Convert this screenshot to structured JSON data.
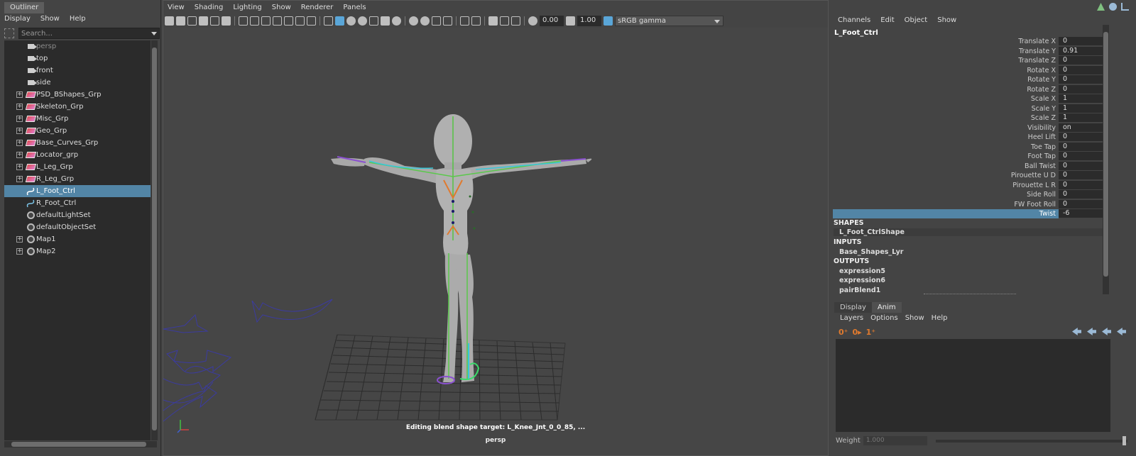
{
  "outliner": {
    "tab": "Outliner",
    "menu": [
      "Display",
      "Show",
      "Help"
    ],
    "search_placeholder": "Search...",
    "items": [
      {
        "label": "persp",
        "type": "camera",
        "expandable": false,
        "dim": true
      },
      {
        "label": "top",
        "type": "camera",
        "expandable": false
      },
      {
        "label": "front",
        "type": "camera",
        "expandable": false
      },
      {
        "label": "side",
        "type": "camera",
        "expandable": false
      },
      {
        "label": "PSD_BShapes_Grp",
        "type": "group",
        "expandable": true
      },
      {
        "label": "Skeleton_Grp",
        "type": "group",
        "expandable": true
      },
      {
        "label": "Misc_Grp",
        "type": "group",
        "expandable": true
      },
      {
        "label": "Geo_Grp",
        "type": "group",
        "expandable": true
      },
      {
        "label": "Base_Curves_Grp",
        "type": "group",
        "expandable": true
      },
      {
        "label": "Locator_grp",
        "type": "group",
        "expandable": true
      },
      {
        "label": "L_Leg_Grp",
        "type": "group",
        "expandable": true
      },
      {
        "label": "R_Leg_Grp",
        "type": "group",
        "expandable": true
      },
      {
        "label": "L_Foot_Ctrl",
        "type": "curve",
        "expandable": false,
        "selected": true
      },
      {
        "label": "R_Foot_Ctrl",
        "type": "curve",
        "expandable": false
      },
      {
        "label": "defaultLightSet",
        "type": "set",
        "expandable": false
      },
      {
        "label": "defaultObjectSet",
        "type": "set",
        "expandable": false
      },
      {
        "label": "Map1",
        "type": "set",
        "expandable": true
      },
      {
        "label": "Map2",
        "type": "set",
        "expandable": true
      }
    ]
  },
  "viewport": {
    "menu": [
      "View",
      "Shading",
      "Lighting",
      "Show",
      "Renderer",
      "Panels"
    ],
    "exposure": "0.00",
    "gamma": "1.00",
    "color_space": "sRGB gamma",
    "hud_message": "Editing blend shape target: L_Knee_Jnt_0_0_85, ...",
    "camera_name": "persp"
  },
  "channel_box": {
    "menu": [
      "Channels",
      "Edit",
      "Object",
      "Show"
    ],
    "object_name": "L_Foot_Ctrl",
    "attributes": [
      {
        "name": "Translate X",
        "value": "0"
      },
      {
        "name": "Translate Y",
        "value": "0.91"
      },
      {
        "name": "Translate Z",
        "value": "0"
      },
      {
        "name": "Rotate X",
        "value": "0"
      },
      {
        "name": "Rotate Y",
        "value": "0"
      },
      {
        "name": "Rotate Z",
        "value": "0"
      },
      {
        "name": "Scale X",
        "value": "1"
      },
      {
        "name": "Scale Y",
        "value": "1"
      },
      {
        "name": "Scale Z",
        "value": "1"
      },
      {
        "name": "Visibility",
        "value": "on"
      },
      {
        "name": "Heel Lift",
        "value": "0"
      },
      {
        "name": "Toe Tap",
        "value": "0"
      },
      {
        "name": "Foot Tap",
        "value": "0"
      },
      {
        "name": "Ball Twist",
        "value": "0"
      },
      {
        "name": "Pirouette U D",
        "value": "0"
      },
      {
        "name": "Pirouette L R",
        "value": "0"
      },
      {
        "name": "Side Roll",
        "value": "0"
      },
      {
        "name": "FW Foot Roll",
        "value": "0"
      },
      {
        "name": "Twist",
        "value": "-6",
        "selected": true
      }
    ],
    "shapes_header": "SHAPES",
    "shapes": [
      "L_Foot_CtrlShape"
    ],
    "inputs_header": "INPUTS",
    "inputs": [
      "Base_Shapes_Lyr"
    ],
    "outputs_header": "OUTPUTS",
    "outputs": [
      "expression5",
      "expression6",
      "pairBlend1"
    ]
  },
  "layer_editor": {
    "tabs": [
      "Display",
      "Anim"
    ],
    "active_tab": "Anim",
    "menu": [
      "Layers",
      "Options",
      "Show",
      "Help"
    ],
    "weight_label": "Weight",
    "weight_value": "1.000"
  },
  "colors": {
    "selection": "#5285a6",
    "background": "#444444",
    "field": "#2b2b2b"
  }
}
